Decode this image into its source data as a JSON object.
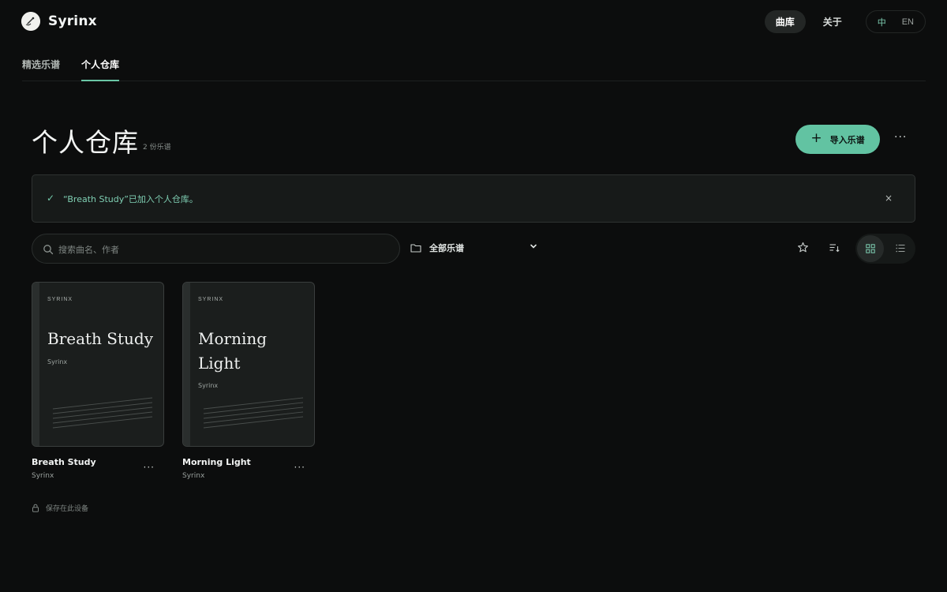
{
  "brand": {
    "name": "Syrinx"
  },
  "nav": {
    "library": "曲库",
    "about": "关于",
    "lang_zh": "中",
    "lang_en": "EN"
  },
  "tabs": [
    {
      "label": "精选乐谱"
    },
    {
      "label": "个人仓库"
    }
  ],
  "header": {
    "title": "个人仓库",
    "count": "2 份乐谱",
    "import_label": "导入乐谱"
  },
  "notice": {
    "message": "“Breath Study”已加入个人仓库。",
    "close": "×"
  },
  "search": {
    "placeholder": "搜索曲名、作者",
    "value": ""
  },
  "filter": {
    "folder_label": "全部乐谱"
  },
  "scores": [
    {
      "brand_tag": "SYRINX",
      "title": "Breath Study",
      "author": "Syrinx"
    },
    {
      "brand_tag": "SYRINX",
      "title": "Morning Light",
      "author": "Syrinx"
    }
  ],
  "footer": {
    "storage_note": "保存在此设备"
  },
  "colors": {
    "accent": "#62c3a2",
    "background": "#0c0d0d",
    "card": "#1b1e1d"
  },
  "icons": [
    "logo-icon",
    "check-icon",
    "search-icon",
    "folder-icon",
    "chevron-down-icon",
    "star-icon",
    "sort-icon",
    "grid-view-icon",
    "list-view-icon",
    "lock-icon",
    "more-icon",
    "plus-icon"
  ]
}
